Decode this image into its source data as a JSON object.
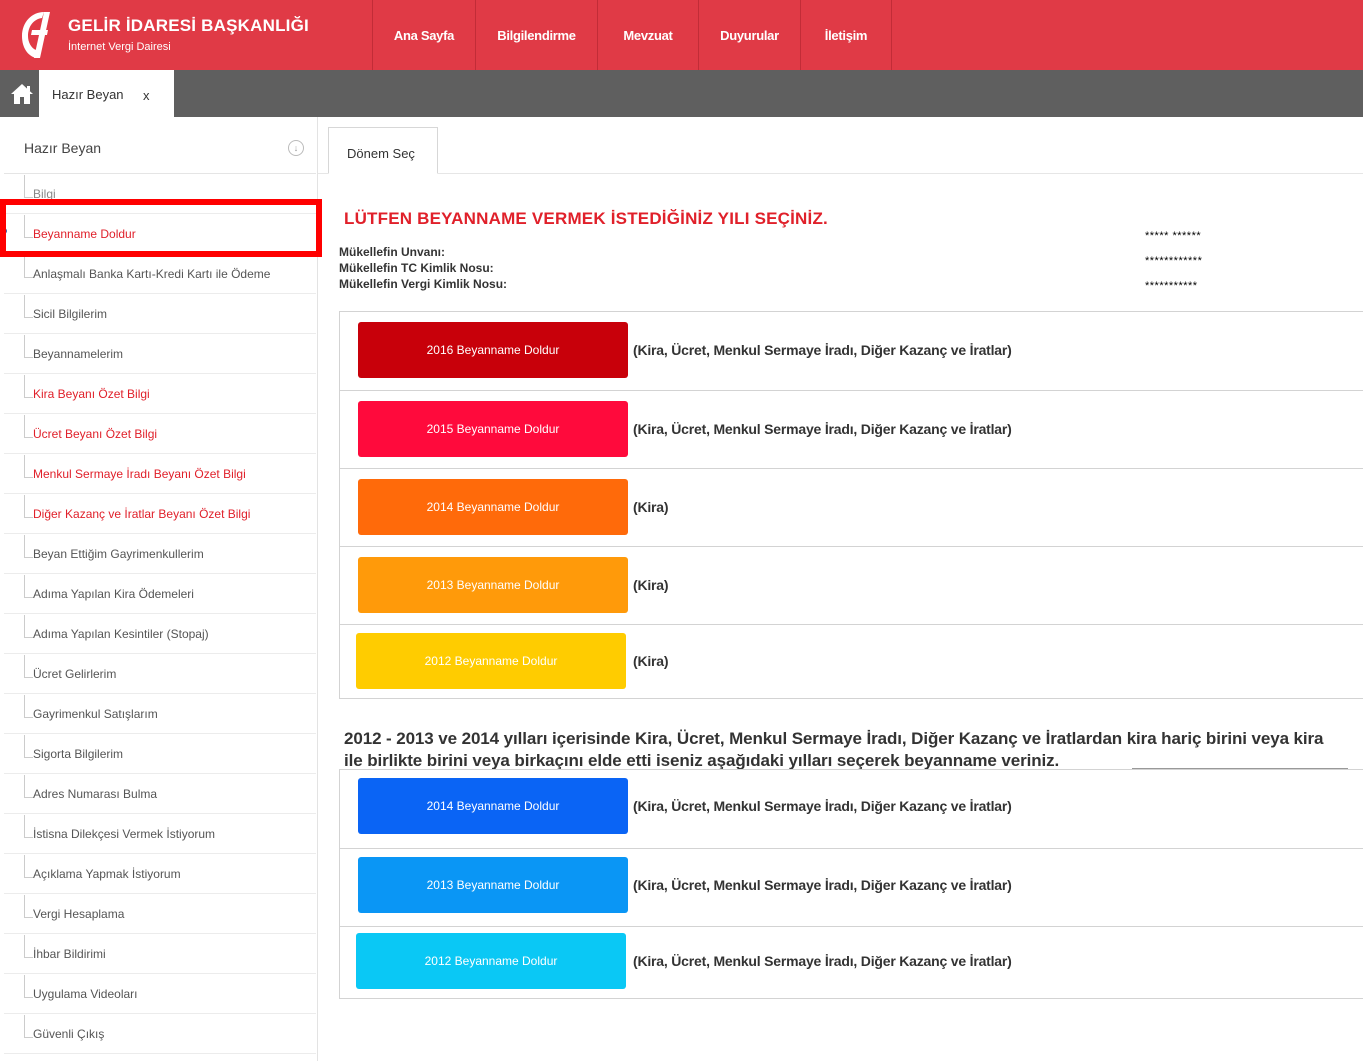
{
  "brand": {
    "title": "GELİR İDARESİ BAŞKANLIĞI",
    "subtitle": "İnternet Vergi Dairesi",
    "color": "#e03a46"
  },
  "nav": [
    {
      "label": "Ana Sayfa"
    },
    {
      "label": "Bilgilendirme"
    },
    {
      "label": "Mevzuat"
    },
    {
      "label": "Duyurular"
    },
    {
      "label": "İletişim"
    }
  ],
  "tabbar": {
    "home_icon": "home-icon",
    "open_tab": {
      "label": "Hazır Beyan",
      "close": "x"
    }
  },
  "sidebar": {
    "header": "Hazır Beyan",
    "collapse_icon": "arrow-down-circle-icon",
    "items": [
      {
        "label": "Bilgi",
        "style": "muted"
      },
      {
        "label": "Beyanname Doldur",
        "style": "red"
      },
      {
        "label": "Anlaşmalı Banka Kartı-Kredi Kartı ile Ödeme",
        "style": "normal"
      },
      {
        "label": "Sicil Bilgilerim",
        "style": "normal"
      },
      {
        "label": "Beyannamelerim",
        "style": "normal"
      },
      {
        "label": "Kira Beyanı Özet Bilgi",
        "style": "red"
      },
      {
        "label": "Ücret Beyanı Özet Bilgi",
        "style": "red"
      },
      {
        "label": "Menkul Sermaye İradı Beyanı Özet Bilgi",
        "style": "red"
      },
      {
        "label": "Diğer Kazanç ve İratlar Beyanı Özet Bilgi",
        "style": "red"
      },
      {
        "label": "Beyan Ettiğim Gayrimenkullerim",
        "style": "normal"
      },
      {
        "label": "Adıma Yapılan Kira Ödemeleri",
        "style": "normal"
      },
      {
        "label": "Adıma Yapılan Kesintiler (Stopaj)",
        "style": "normal"
      },
      {
        "label": "Ücret Gelirlerim",
        "style": "normal"
      },
      {
        "label": "Gayrimenkul Satışlarım",
        "style": "normal"
      },
      {
        "label": "Sigorta Bilgilerim",
        "style": "normal"
      },
      {
        "label": "Adres Numarası Bulma",
        "style": "normal"
      },
      {
        "label": "İstisna Dilekçesi Vermek İstiyorum",
        "style": "normal"
      },
      {
        "label": "Açıklama Yapmak İstiyorum",
        "style": "normal"
      },
      {
        "label": "Vergi Hesaplama",
        "style": "normal"
      },
      {
        "label": "İhbar Bildirimi",
        "style": "normal"
      },
      {
        "label": "Uygulama Videoları",
        "style": "normal"
      },
      {
        "label": "Güvenli Çıkış",
        "style": "normal"
      }
    ]
  },
  "main": {
    "tab_label": "Dönem Seç",
    "heading": "LÜTFEN BEYANNAME VERMEK İSTEDİĞİNİZ YILI SEÇİNİZ.",
    "taxpayer": {
      "name_label": "Mükellefin Unvanı:",
      "name_value": "***** ******",
      "tc_label": "Mükellefin TC Kimlik Nosu:",
      "tc_value": "************",
      "vkn_label": "Mükellefin Vergi Kimlik Nosu:",
      "vkn_value": "***********"
    },
    "returns_group1": [
      {
        "label": "2016 Beyanname Doldur",
        "desc": "(Kira, Ücret, Menkul Sermaye İradı, Diğer Kazanç ve İratlar)",
        "color": "#c8000a"
      },
      {
        "label": "2015 Beyanname Doldur",
        "desc": "(Kira, Ücret, Menkul Sermaye İradı, Diğer Kazanç ve İratlar)",
        "color": "#ff0a3c"
      },
      {
        "label": "2014 Beyanname Doldur",
        "desc": "(Kira)",
        "color": "#ff6a0a"
      },
      {
        "label": "2013 Beyanname Doldur",
        "desc": "(Kira)",
        "color": "#ff9a0a"
      },
      {
        "label": "2012 Beyanname Doldur",
        "desc": "(Kira)",
        "color": "#ffcc00"
      }
    ],
    "note": "2012 - 2013 ve 2014 yılları içerisinde Kira, Ücret, Menkul Sermaye İradı, Diğer Kazanç ve İratlardan kira hariç birini veya kira ile birlikte birini veya birkaçını elde etti iseniz aşağıdaki yılları seçerek beyanname veriniz.",
    "returns_group2": [
      {
        "label": "2014 Beyanname Doldur",
        "desc": "(Kira, Ücret, Menkul Sermaye İradı, Diğer Kazanç ve İratlar)",
        "color": "#0a64f5"
      },
      {
        "label": "2013 Beyanname Doldur",
        "desc": "(Kira, Ücret, Menkul Sermaye İradı, Diğer Kazanç ve İratlar)",
        "color": "#0a96f5"
      },
      {
        "label": "2012 Beyanname Doldur",
        "desc": "(Kira, Ücret, Menkul Sermaye İradı, Diğer Kazanç ve İratlar)",
        "color": "#0ac8f5"
      }
    ]
  }
}
